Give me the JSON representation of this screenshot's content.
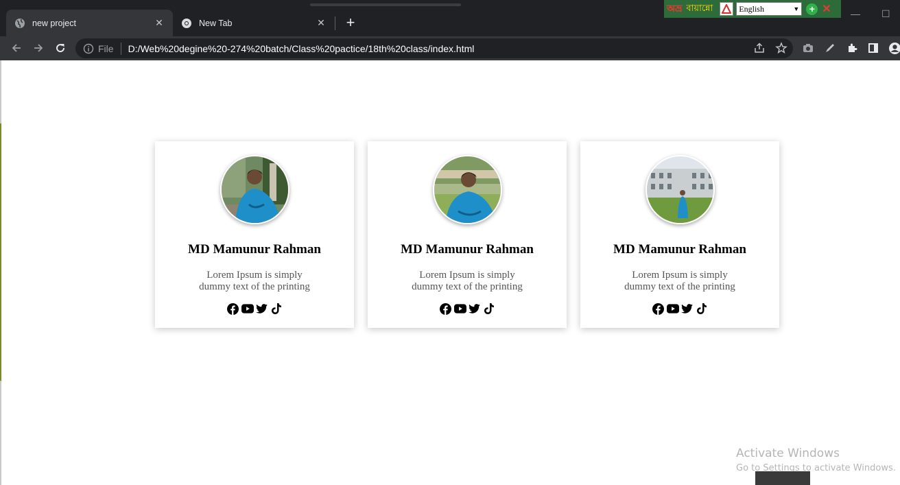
{
  "browser": {
    "tabs": [
      {
        "title": "new project",
        "active": true
      },
      {
        "title": "New Tab",
        "active": false
      }
    ],
    "address": {
      "scheme_label": "File",
      "url": "D:/Web%20degine%20-274%20batch/Class%20pactice/18th%20class/index.html"
    },
    "extension": {
      "logo": "অভ্র",
      "label": "বায়ান্নো",
      "language": "English"
    }
  },
  "cards": [
    {
      "name": "MD Mamunur Rahman",
      "description": "Lorem Ipsum is simply dummy text of the printing",
      "avatar": "photo-garden"
    },
    {
      "name": "MD Mamunur Rahman",
      "description": "Lorem Ipsum is simply dummy text of the printing",
      "avatar": "photo-lawn"
    },
    {
      "name": "MD Mamunur Rahman",
      "description": "Lorem Ipsum is simply dummy text of the printing",
      "avatar": "photo-building"
    }
  ],
  "social_icons": [
    "facebook-icon",
    "youtube-icon",
    "twitter-icon",
    "tiktok-icon"
  ],
  "watermark": {
    "title": "Activate Windows",
    "subtitle": "Go to Settings to activate Windows."
  }
}
